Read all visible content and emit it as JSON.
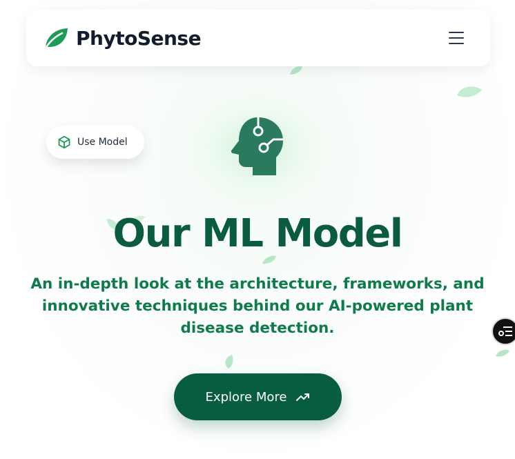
{
  "navbar": {
    "brand_name": "PhytoSense",
    "brand_icon": "leaf-icon",
    "menu_icon": "hamburger-menu-icon"
  },
  "hero": {
    "pill_label": "Use Model",
    "pill_icon": "cube-icon",
    "head_icon": "ai-head-circuit-icon",
    "title": "Our ML Model",
    "subtitle_lines": [
      "An in-depth look at the architecture, frameworks, and",
      "innovative techniques behind our AI-powered plant",
      "disease detection."
    ],
    "cta_label": "Explore More",
    "cta_icon": "trending-up-icon"
  },
  "floating_button": {
    "icon": "settings-list-icon"
  },
  "colors": {
    "primary_dark": "#075c42",
    "title_green": "#0b5b3f",
    "subtitle_green": "#0f7a4a",
    "leaf_green": "#1d9a57",
    "brand_text": "#111c2d"
  }
}
